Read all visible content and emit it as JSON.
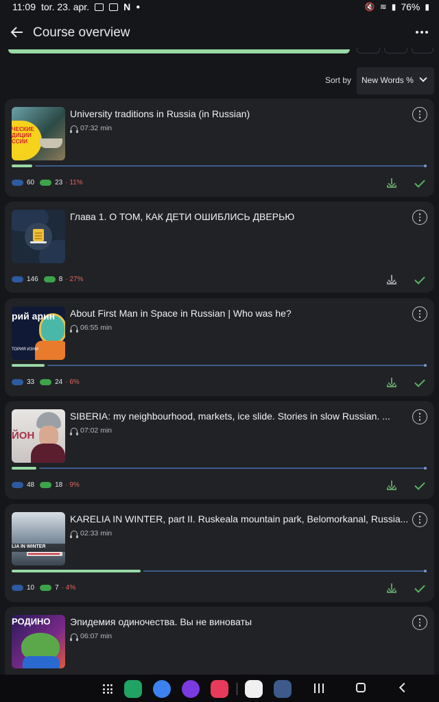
{
  "status": {
    "time": "11:09",
    "date": "tor. 23. apr.",
    "battery": "76%"
  },
  "header": {
    "title": "Course overview"
  },
  "sort": {
    "label": "Sort by",
    "value": "New Words %"
  },
  "cards": [
    {
      "title": "University traditions in Russia (in Russian)",
      "duration": "07:32 min",
      "blue": "60",
      "green": "23",
      "percent": "11%",
      "progress": 0.05,
      "thumb_text": "ЧЕСКИЕ ДИЦИИ ССИИ"
    },
    {
      "title": "Глава 1. О ТОМ, КАК ДЕТИ ОШИБЛИСЬ ДВЕРЬЮ",
      "duration": "",
      "blue": "146",
      "green": "8",
      "percent": "27%",
      "progress": null
    },
    {
      "title": "About First Man in Space in Russian | Who was he?",
      "duration": "06:55 min",
      "blue": "33",
      "green": "24",
      "percent": "6%",
      "progress": 0.08,
      "thumb_text1": "рий арин",
      "thumb_text2": "ТОРИЯ ИЗНИ"
    },
    {
      "title": "SIBERIA: my neighbourhood, markets, ice slide. Stories in slow Russian. ...",
      "duration": "07:02 min",
      "blue": "48",
      "green": "18",
      "percent": "9%",
      "progress": 0.06,
      "thumb_text": "ЙОН"
    },
    {
      "title": "KARELIA IN WINTER, part II. Ruskeala mountain park, Belomorkanal, Russia...",
      "duration": "02:33 min",
      "blue": "10",
      "green": "7",
      "percent": "4%",
      "progress": 0.31,
      "thumb_text": "LIA IN WINTER"
    },
    {
      "title": "Эпидемия одиночества. Вы не виноваты",
      "duration": "06:07 min",
      "thumb_text": "РОДИНО"
    }
  ]
}
